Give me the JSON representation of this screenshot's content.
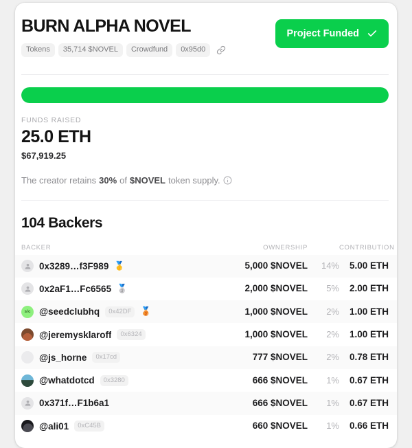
{
  "project": {
    "title": "BURN ALPHA NOVEL",
    "chips": [
      {
        "label": "Tokens"
      },
      {
        "label": "35,714 $NOVEL"
      },
      {
        "label": "Crowdfund"
      },
      {
        "label": "0x95d0"
      }
    ],
    "link_icon": "link-icon",
    "status_button": {
      "label": "Project Funded",
      "icon": "check-icon",
      "color": "#0ACF4C"
    }
  },
  "funding": {
    "progress_percent": 100,
    "bar_color": "#0ACF4C",
    "label": "FUNDS RAISED",
    "amount_eth": "25.0 ETH",
    "amount_usd": "$67,919.25",
    "retain_prefix": "The creator retains",
    "retain_percent": "30%",
    "retain_middle": "of",
    "retain_token": "$NOVEL",
    "retain_suffix": "token supply.",
    "info_icon": "info-icon"
  },
  "backers": {
    "heading": "104 Backers",
    "count": 104,
    "columns": {
      "backer": "BACKER",
      "ownership": "OWNERSHIP",
      "contribution": "CONTRIBUTION"
    },
    "rows": [
      {
        "name": "0x3289…f3F989",
        "hash": "",
        "avatar": "person-placeholder",
        "avatar_style": "gray",
        "medal": "🥇",
        "ownership": "5,000 $NOVEL",
        "percent": "14%",
        "eth": "5.00 ETH"
      },
      {
        "name": "0x2aF1…Fc6565",
        "hash": "",
        "avatar": "person-placeholder",
        "avatar_style": "gray",
        "medal": "🥈",
        "ownership": "2,000 $NOVEL",
        "percent": "5%",
        "eth": "2.00 ETH"
      },
      {
        "name": "@seedclubhq",
        "hash": "0x42DF",
        "avatar": "seedclub-logo",
        "avatar_style": "seedclub",
        "avatar_text": "s/c",
        "medal": "🥉",
        "ownership": "1,000 $NOVEL",
        "percent": "2%",
        "eth": "1.00 ETH"
      },
      {
        "name": "@jeremysklaroff",
        "hash": "0x6324",
        "avatar": "user-photo",
        "avatar_style": "photo-1",
        "medal": "",
        "ownership": "1,000 $NOVEL",
        "percent": "2%",
        "eth": "1.00 ETH"
      },
      {
        "name": "@js_horne",
        "hash": "0x17cd",
        "avatar": "user-photo",
        "avatar_style": "photo-blank",
        "medal": "",
        "ownership": "777 $NOVEL",
        "percent": "2%",
        "eth": "0.78 ETH"
      },
      {
        "name": "@whatdotcd",
        "hash": "0x3280",
        "avatar": "user-photo",
        "avatar_style": "photo-2",
        "medal": "",
        "ownership": "666 $NOVEL",
        "percent": "1%",
        "eth": "0.67 ETH"
      },
      {
        "name": "0x371f…F1b6a1",
        "hash": "",
        "avatar": "person-placeholder",
        "avatar_style": "gray",
        "medal": "",
        "ownership": "666 $NOVEL",
        "percent": "1%",
        "eth": "0.67 ETH"
      },
      {
        "name": "@ali01",
        "hash": "0xC45B",
        "avatar": "user-photo",
        "avatar_style": "photo-3",
        "medal": "",
        "ownership": "660 $NOVEL",
        "percent": "1%",
        "eth": "0.66 ETH"
      }
    ]
  }
}
